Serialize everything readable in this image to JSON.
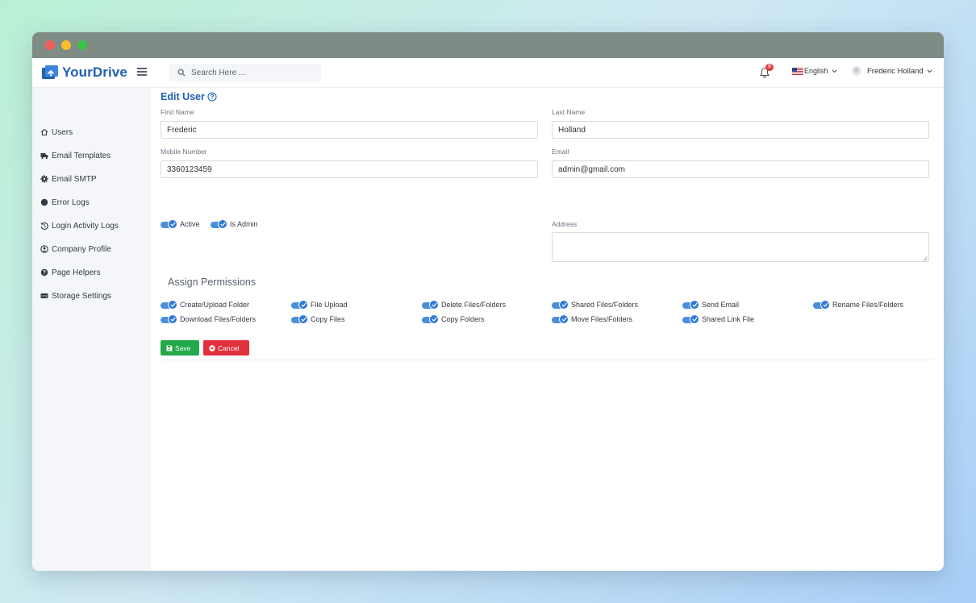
{
  "app": {
    "name": "YourDrive"
  },
  "colors": {
    "brand": "#1f5fb4",
    "toggle": "#2f7bd6",
    "save": "#23a84a",
    "cancel": "#e0303d",
    "badge": "#e04444"
  },
  "header": {
    "search_placeholder": "Search Here ...",
    "notification_count": "0",
    "language": "English",
    "user_name": "Frederic Holland"
  },
  "sidebar": {
    "items": [
      {
        "label": "Users",
        "icon": "home-icon"
      },
      {
        "label": "Email Templates",
        "icon": "truck-icon"
      },
      {
        "label": "Email SMTP",
        "icon": "gear-icon"
      },
      {
        "label": "Error Logs",
        "icon": "circle-icon"
      },
      {
        "label": "Login Activity Logs",
        "icon": "history-icon"
      },
      {
        "label": "Company Profile",
        "icon": "user-circle-icon"
      },
      {
        "label": "Page Helpers",
        "icon": "question-circle-icon"
      },
      {
        "label": "Storage Settings",
        "icon": "hdd-icon"
      }
    ]
  },
  "form": {
    "title": "Edit User",
    "first_name": {
      "label": "First Name",
      "value": "Frederic"
    },
    "last_name": {
      "label": "Last Name",
      "value": "Holland"
    },
    "mobile": {
      "label": "Mobile Number",
      "value": "3360123459"
    },
    "email": {
      "label": "Email",
      "value": "admin@gmail.com"
    },
    "address": {
      "label": "Address",
      "value": ""
    },
    "active": {
      "label": "Active",
      "checked": true
    },
    "is_admin": {
      "label": "Is Admin",
      "checked": true
    }
  },
  "permissions": {
    "title": "Assign Permissions",
    "items": [
      {
        "label": "Create/Upload Folder",
        "checked": true
      },
      {
        "label": "File Upload",
        "checked": true
      },
      {
        "label": "Delete Files/Folders",
        "checked": true
      },
      {
        "label": "Shared Files/Folders",
        "checked": true
      },
      {
        "label": "Send Email",
        "checked": true
      },
      {
        "label": "Rename Files/Folders",
        "checked": true
      },
      {
        "label": "Download Files/Folders",
        "checked": true
      },
      {
        "label": "Copy Files",
        "checked": true
      },
      {
        "label": "Copy Folders",
        "checked": true
      },
      {
        "label": "Move Files/Folders",
        "checked": true
      },
      {
        "label": "Shared Link File",
        "checked": true
      }
    ]
  },
  "buttons": {
    "save": "Save",
    "cancel": "Cancel"
  }
}
